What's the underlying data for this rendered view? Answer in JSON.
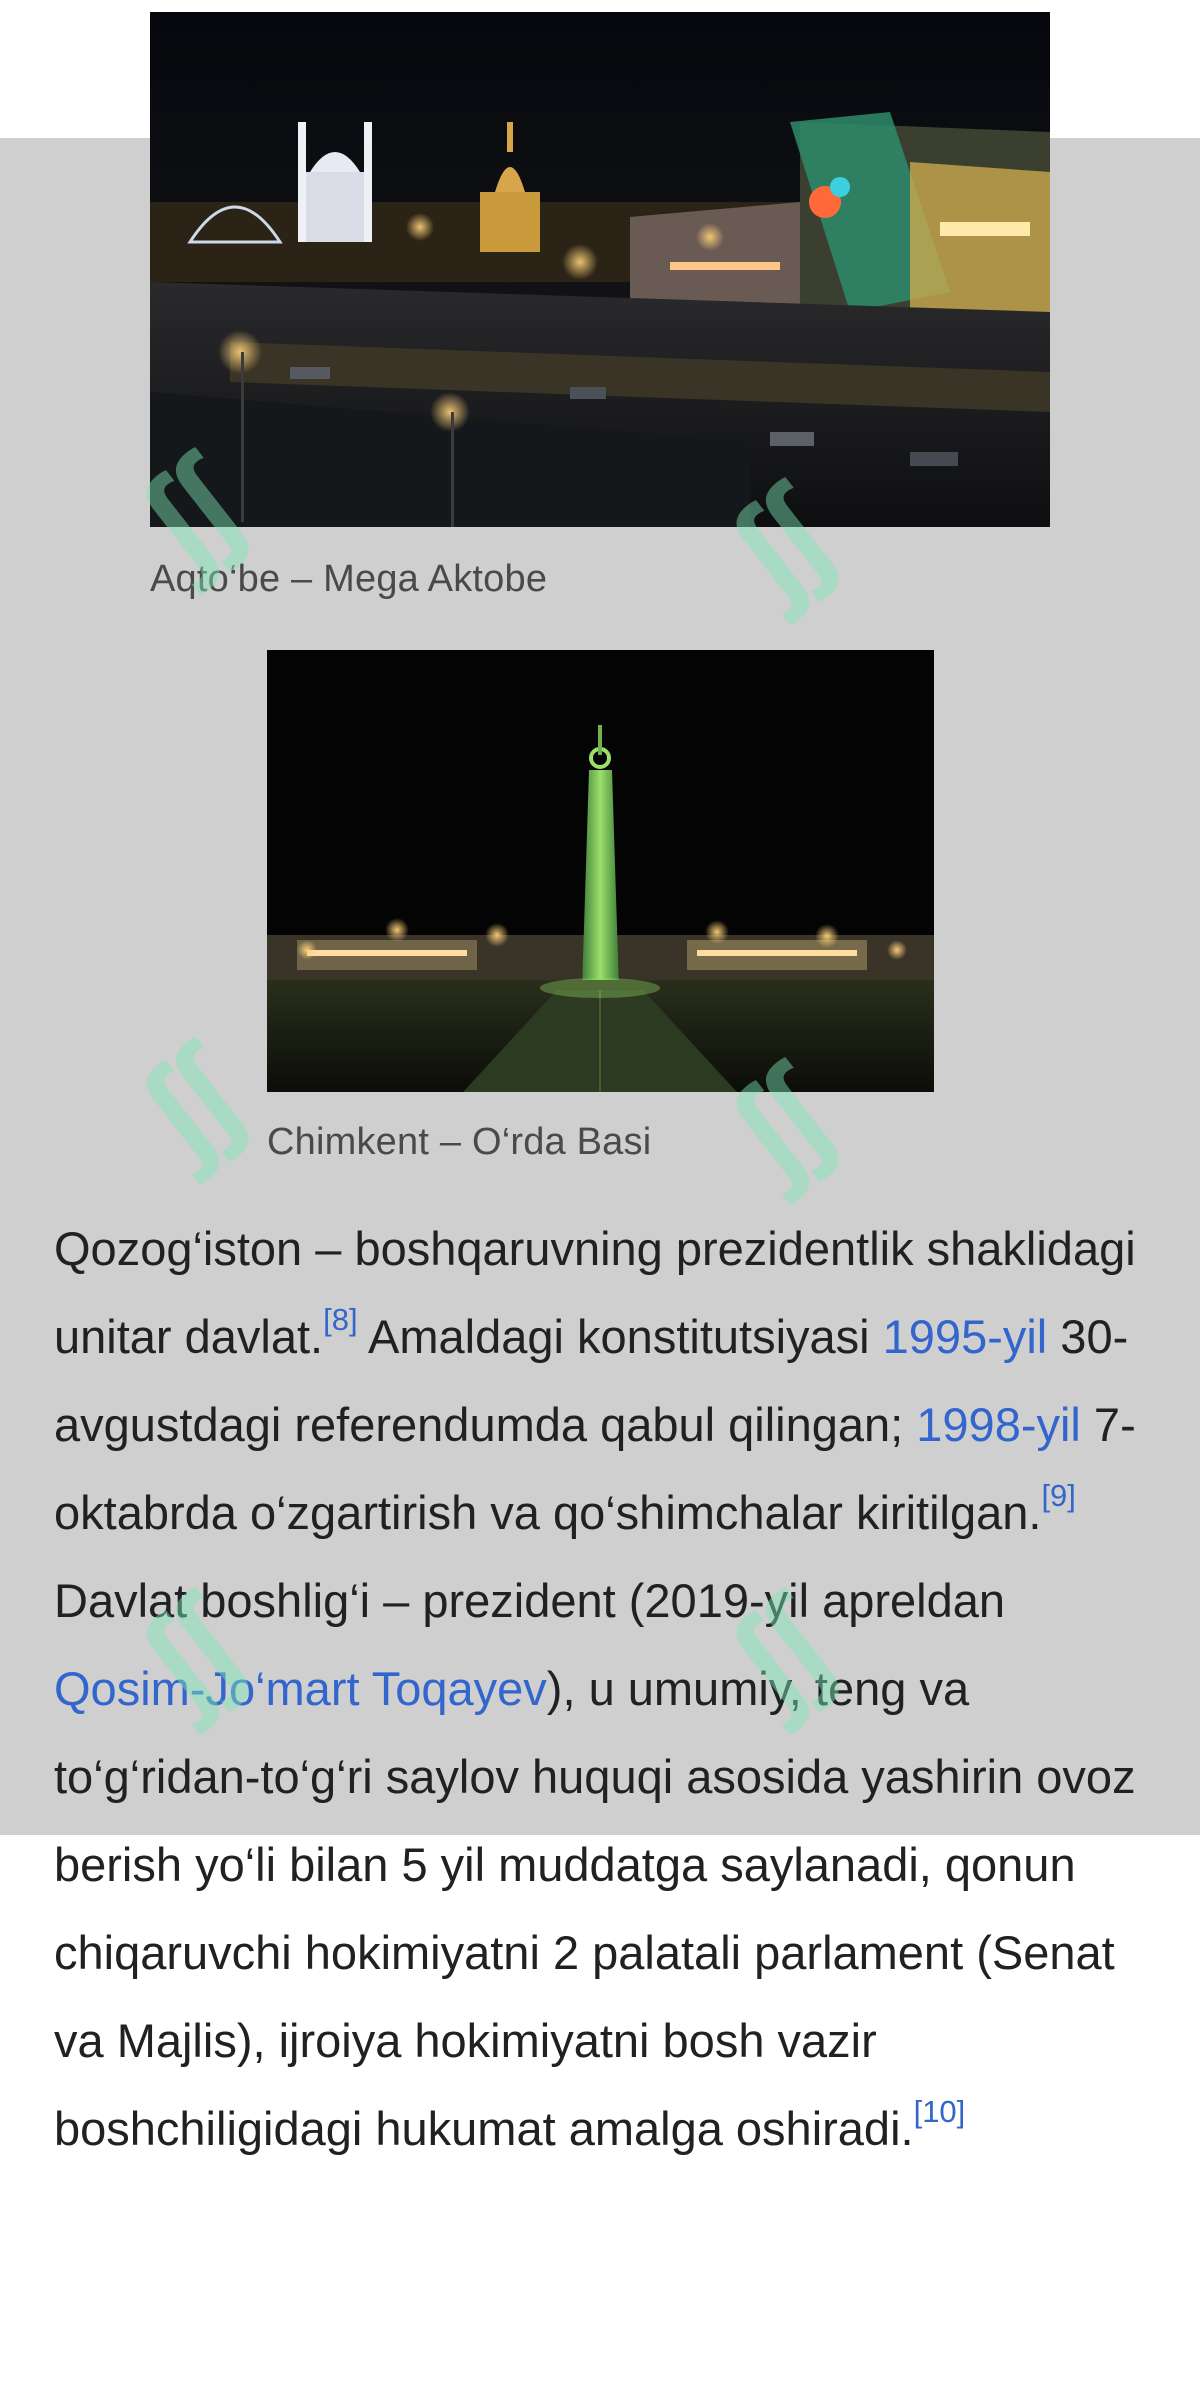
{
  "figures": [
    {
      "caption": "Aqto‘be – Mega Aktobe",
      "image": "night-city-mall-photo"
    },
    {
      "caption": "Chimkent – O‘rda Basi",
      "image": "night-monument-photo"
    }
  ],
  "article": {
    "p1": "Qozog‘iston – boshqaruvning prezidentlik shaklidagi unitar davlat.",
    "ref8": "[8]",
    "p2": " Amaldagi konstitutsiyasi ",
    "link_1995": "1995-yil",
    "p3": " 30-avgustdagi referendumda qabul qilingan; ",
    "link_1998": "1998-yil",
    "p4": " 7-oktabrda o‘zgartirish va qo‘shimchalar kiritilgan.",
    "ref9": "[9]",
    "p5": " Davlat boshlig‘i – prezident (2019-yil apreldan ",
    "link_president": "Qosim-Jo‘mart Toqayev",
    "p6": "), u umumiy, teng va to‘g‘ridan-to‘g‘ri saylov huquqi asosida yashirin ovoz berish yo‘li bilan 5 yil muddatga saylanadi, qonun chiqaruvchi hokimiyatni 2 palatali parlament (Senat va Majlis), ijroiya hokimiyatni bosh vazir boshchiligidagi hukumat amalga oshiradi.",
    "ref10": "[10]"
  },
  "colors": {
    "link": "#3366cc",
    "text": "#202122",
    "caption": "#4a4a4a",
    "overlay": "#cfcfcf",
    "watermark": "#7de8b8"
  }
}
